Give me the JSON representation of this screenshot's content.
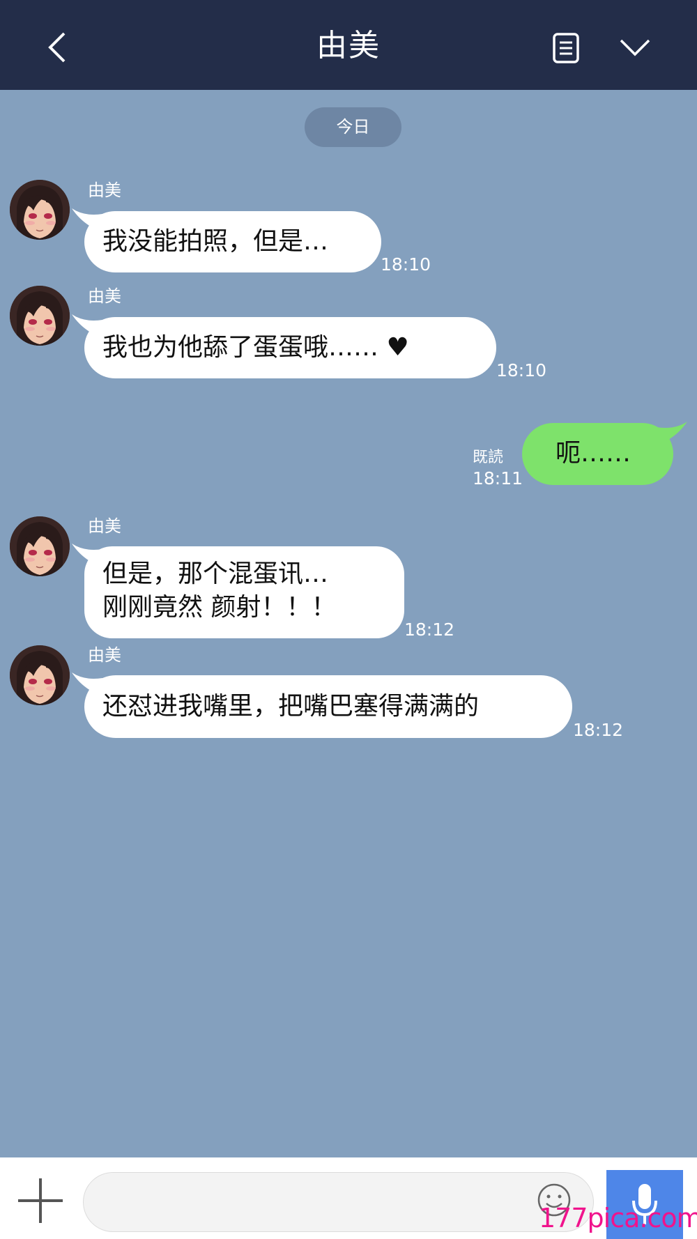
{
  "header": {
    "title": "由美",
    "back_icon": "chevron-left-icon",
    "notes_icon": "notes-icon",
    "menu_icon": "chevron-down-icon",
    "background": "#232d49"
  },
  "chat": {
    "date_label": "今日",
    "background": "#84a0be",
    "messages": [
      {
        "sender": "由美",
        "text": "我没能拍照，但是…",
        "time": "18:10"
      },
      {
        "sender": "由美",
        "text": "我也为他舔了蛋蛋哦…… ♥",
        "time": "18:10"
      },
      {
        "sender": "me",
        "text": "呃……",
        "read": "既読",
        "time": "18:11"
      },
      {
        "sender": "由美",
        "lines": [
          "但是，那个混蛋讯…",
          "刚刚竟然 颜射！！！"
        ],
        "time": "18:12"
      },
      {
        "sender": "由美",
        "text": "还怼进我嘴里，把嘴巴塞得满满的",
        "time": "18:12"
      }
    ]
  },
  "footer": {
    "plus_icon": "plus-icon",
    "input_value": "",
    "emoji_icon": "emoji-icon",
    "mic_icon": "microphone-icon",
    "mic_color": "#4e86e8"
  },
  "watermark": "177pica.com"
}
